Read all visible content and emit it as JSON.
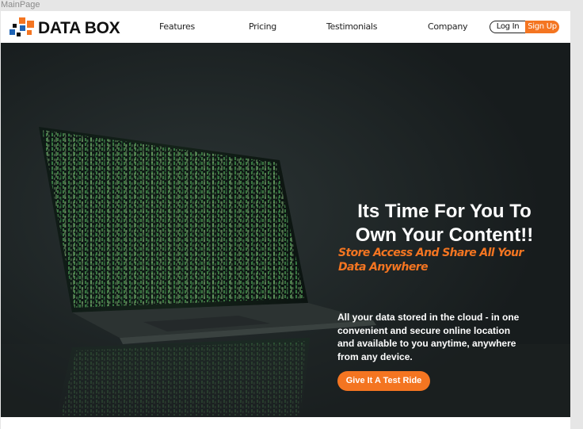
{
  "frame": {
    "label": "MainPage"
  },
  "brand": {
    "name": "DATA BOX",
    "logo_colors": [
      "#f47521",
      "#1e63b5",
      "#111111"
    ]
  },
  "nav": {
    "items": [
      {
        "label": "Features"
      },
      {
        "label": "Pricing"
      },
      {
        "label": "Testimonials"
      },
      {
        "label": "Company"
      }
    ],
    "login_label": "Log In",
    "signup_label": "Sign Up"
  },
  "hero": {
    "title_line1": "Its Time For You To",
    "title_line2": "Own Your Content!!",
    "subtitle": "Store Access And Share All Your Data Anywhere",
    "body": "All your data stored in the cloud - in one convenient and secure online location and available to you anytime, anywhere from any device.",
    "cta_label": "Give It A Test Ride",
    "image": "laptop-with-green-code-on-screen"
  },
  "colors": {
    "accent": "#f47521",
    "hero_background": "#1f2526",
    "header_background": "#ffffff"
  }
}
